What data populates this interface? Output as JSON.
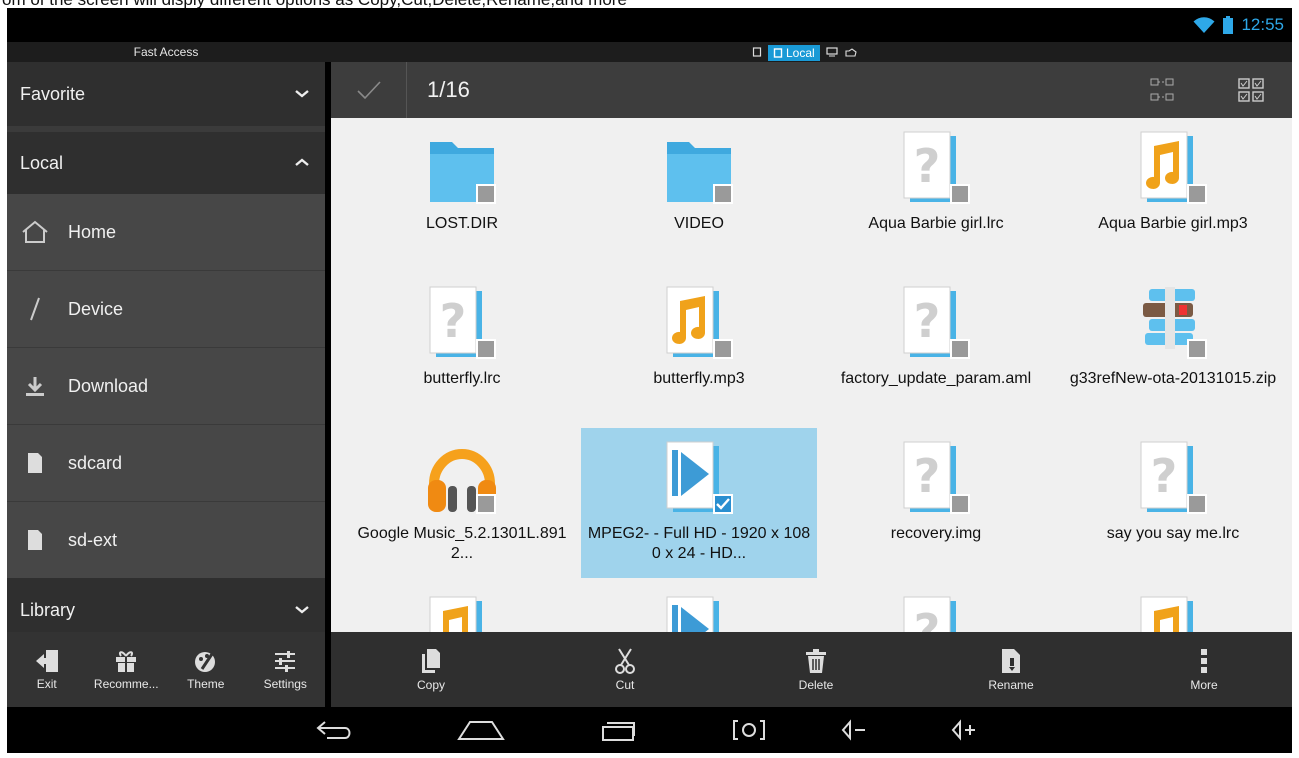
{
  "caption": "om of the screen will disply different options as Copy,Cut,Delete,Rename,and more",
  "status": {
    "time": "12:55"
  },
  "header": {
    "fast_access": "Fast Access",
    "location_tab": "Local"
  },
  "sidebar": {
    "sections": [
      {
        "label": "Favorite"
      },
      {
        "label": "Local"
      },
      {
        "label": "Library"
      }
    ],
    "items": [
      {
        "label": "Home",
        "icon": "home-icon"
      },
      {
        "label": "Device",
        "icon": "slash-icon"
      },
      {
        "label": "Download",
        "icon": "download-icon"
      },
      {
        "label": "sdcard",
        "icon": "sdcard-icon"
      },
      {
        "label": "sd-ext",
        "icon": "sdcard-icon"
      }
    ],
    "actions": [
      {
        "label": "Exit",
        "icon": "exit-icon"
      },
      {
        "label": "Recomme...",
        "icon": "gift-icon"
      },
      {
        "label": "Theme",
        "icon": "palette-icon"
      },
      {
        "label": "Settings",
        "icon": "sliders-icon"
      }
    ]
  },
  "toolbar": {
    "selection_count": "1/16"
  },
  "files": [
    {
      "name": "LOST.DIR",
      "type": "folder",
      "checked": false
    },
    {
      "name": "VIDEO",
      "type": "folder",
      "checked": false
    },
    {
      "name": "Aqua  Barbie girl.lrc",
      "type": "unknown",
      "checked": false
    },
    {
      "name": "Aqua  Barbie girl.mp3",
      "type": "audio",
      "checked": false
    },
    {
      "name": "butterfly.lrc",
      "type": "unknown",
      "checked": false
    },
    {
      "name": "butterfly.mp3",
      "type": "audio",
      "checked": false
    },
    {
      "name": "factory_update_param.aml",
      "type": "unknown",
      "checked": false
    },
    {
      "name": "g33refNew-ota-20131015.zip",
      "type": "zip",
      "checked": false
    },
    {
      "name": "Google Music_5.2.1301L.8912...",
      "type": "apk",
      "checked": false
    },
    {
      "name": "MPEG2-  - Full HD - 1920 x 1080 x 24 -  HD...",
      "type": "video",
      "checked": true
    },
    {
      "name": "recovery.img",
      "type": "unknown",
      "checked": false
    },
    {
      "name": "say you say me.lrc",
      "type": "unknown",
      "checked": false
    },
    {
      "name": "",
      "type": "audio",
      "checked": false
    },
    {
      "name": "",
      "type": "video",
      "checked": false
    },
    {
      "name": "",
      "type": "unknown",
      "checked": false
    },
    {
      "name": "",
      "type": "audio",
      "checked": false
    }
  ],
  "actions": [
    {
      "label": "Copy",
      "icon": "copy-icon"
    },
    {
      "label": "Cut",
      "icon": "scissors-icon"
    },
    {
      "label": "Delete",
      "icon": "trash-icon"
    },
    {
      "label": "Rename",
      "icon": "rename-icon"
    },
    {
      "label": "More",
      "icon": "more-icon"
    }
  ],
  "colors": {
    "accent": "#1a9ad6",
    "selected": "#9fd3ec",
    "folder": "#4db6e8"
  }
}
